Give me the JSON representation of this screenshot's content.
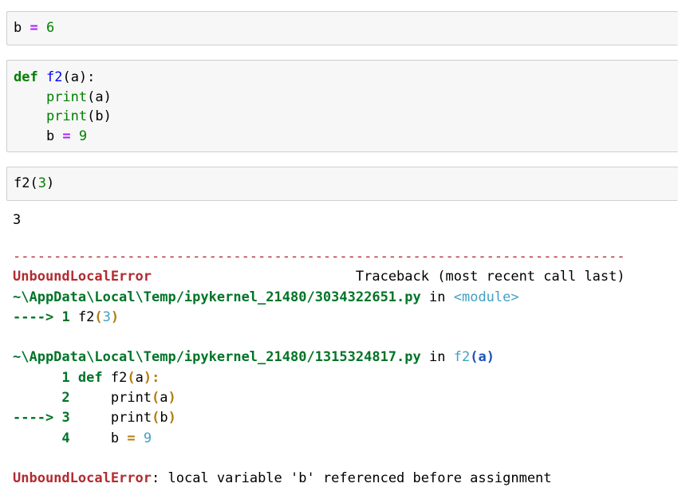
{
  "cells": [
    {
      "code": [
        "b = 6"
      ]
    },
    {
      "code": [
        "def f2(a):",
        "    print(a)",
        "    print(b)",
        "    b = 9"
      ]
    },
    {
      "code": [
        "f2(3)"
      ]
    }
  ],
  "output": {
    "stdout": "3",
    "traceback": {
      "separator": "---------------------------------------------------------------------------",
      "error_name": "UnboundLocalError",
      "header_right": "Traceback (most recent call last)",
      "frames": [
        {
          "file": "~\\AppData\\Local\\Temp/ipykernel_21480/3034322651.py",
          "in_text": "in",
          "context": "<module>",
          "lines": [
            {
              "marker": "---->",
              "lineno": "1",
              "code": "f2(3)"
            }
          ]
        },
        {
          "file": "~\\AppData\\Local\\Temp/ipykernel_21480/1315324817.py",
          "in_text": "in",
          "context": "f2(a)",
          "lines": [
            {
              "marker": "",
              "lineno": "1",
              "code": "def f2(a):"
            },
            {
              "marker": "",
              "lineno": "2",
              "code": "    print(a)"
            },
            {
              "marker": "---->",
              "lineno": "3",
              "code": "    print(b)"
            },
            {
              "marker": "",
              "lineno": "4",
              "code": "    b = 9"
            }
          ]
        }
      ],
      "message": "local variable 'b' referenced before assignment"
    }
  }
}
